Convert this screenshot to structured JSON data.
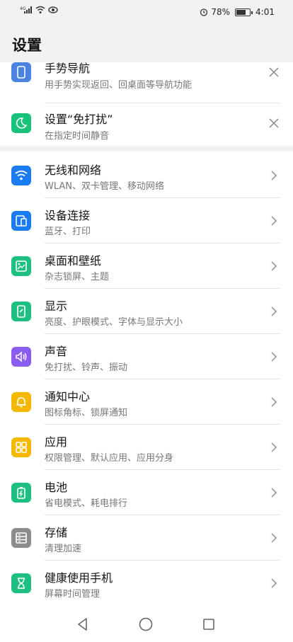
{
  "status_bar": {
    "network": "4G",
    "battery_percent": "78%",
    "battery_level": 0.78,
    "time": "4:01",
    "left_icons": [
      "signal-icon",
      "wifi-icon",
      "eye-comfort-icon"
    ],
    "right_icons": [
      "alarm-icon",
      "battery-icon"
    ]
  },
  "header": {
    "title": "设置"
  },
  "suggestions": [
    {
      "title": "手势导航",
      "subtitle": "用手势实现返回、回桌面等导航功能",
      "icon": "phone-gesture-icon",
      "color": "#4a83e0",
      "action": "close-icon"
    },
    {
      "title": "设置“免打扰”",
      "subtitle": "在指定时间静音",
      "icon": "moon-icon",
      "color": "#17c27a",
      "action": "close-icon"
    }
  ],
  "settings": [
    {
      "title": "无线和网络",
      "subtitle": "WLAN、双卡管理、移动网络",
      "icon": "wifi-icon",
      "color": "#1a7cf0"
    },
    {
      "title": "设备连接",
      "subtitle": "蓝牙、打印",
      "icon": "device-connection-icon",
      "color": "#1a7cf0"
    },
    {
      "title": "桌面和壁纸",
      "subtitle": "杂志锁屏、主题",
      "icon": "wallpaper-icon",
      "color": "#1fbf83"
    },
    {
      "title": "显示",
      "subtitle": "亮度、护眼模式、字体与显示大小",
      "icon": "display-icon",
      "color": "#1fbf83"
    },
    {
      "title": "声音",
      "subtitle": "免打扰、铃声、振动",
      "icon": "speaker-icon",
      "color": "#8a5cf0"
    },
    {
      "title": "通知中心",
      "subtitle": "图标角标、锁屏通知",
      "icon": "bell-icon",
      "color": "#f5b800"
    },
    {
      "title": "应用",
      "subtitle": "权限管理、默认应用、应用分身",
      "icon": "apps-grid-icon",
      "color": "#f5b800"
    },
    {
      "title": "电池",
      "subtitle": "省电模式、耗电排行",
      "icon": "battery-charging-icon",
      "color": "#1fbf83"
    },
    {
      "title": "存储",
      "subtitle": "清理加速",
      "icon": "storage-icon",
      "color": "#8c8c8c"
    },
    {
      "title": "健康使用手机",
      "subtitle": "屏幕时间管理",
      "icon": "hourglass-icon",
      "color": "#1fbf83"
    }
  ],
  "nav_bar": {
    "buttons": [
      "back-icon",
      "home-icon",
      "recents-icon"
    ]
  }
}
